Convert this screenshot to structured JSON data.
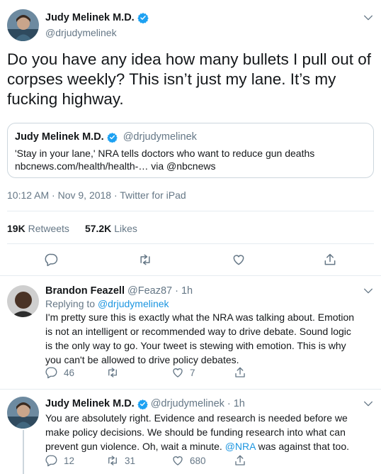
{
  "main_tweet": {
    "author_name": "Judy Melinek M.D.",
    "author_handle": "@drjudymelinek",
    "verified_icon": "verified-badge-icon",
    "text": "Do you have any idea how many bullets I pull out of corpses weekly? This isn’t just my lane. It’s my fucking highway.",
    "quoted": {
      "author_name": "Judy Melinek M.D.",
      "author_handle": "@drjudymelinek",
      "line1": "'Stay in your lane,' NRA tells doctors who want to reduce gun deaths",
      "line2": "nbcnews.com/health/health-… via @nbcnews"
    },
    "meta": "10:12 AM · Nov 9, 2018 · Twitter for iPad",
    "stats": {
      "retweets_count": "19K",
      "retweets_label": "Retweets",
      "likes_count": "57.2K",
      "likes_label": "Likes"
    }
  },
  "replies": [
    {
      "author_name": "Brandon Feazell",
      "author_handle": "@Feaz87",
      "time": "· 1h",
      "replying_prefix": "Replying to",
      "replying_to": "@drjudymelinek",
      "lines": [
        "I'm pretty sure this is exactly what the NRA was talking about.  Emotion",
        "is not an intelligent or recommended way to drive debate.  Sound logic",
        "is the only way to go.  Your tweet is stewing with emotion.  This is why",
        "you can't be allowed to drive policy debates."
      ],
      "reply_count": "46",
      "retweet_count": "",
      "like_count": "7"
    },
    {
      "author_name": "Judy Melinek M.D.",
      "author_handle": "@drjudymelinek",
      "time": "· 1h",
      "lines": [
        "You are absolutely right. Evidence and research is needed before we",
        "make policy decisions. We should be funding research into what can",
        "prevent gun violence. Oh, wait a minute.",
        "was against that too."
      ],
      "mention": "@NRA",
      "reply_count": "12",
      "retweet_count": "31",
      "like_count": "680"
    }
  ],
  "colors": {
    "text": "#14171a",
    "secondary": "#657786",
    "link": "#1b95e0",
    "verified": "#1da1f2",
    "divider": "#e6ecf0"
  }
}
